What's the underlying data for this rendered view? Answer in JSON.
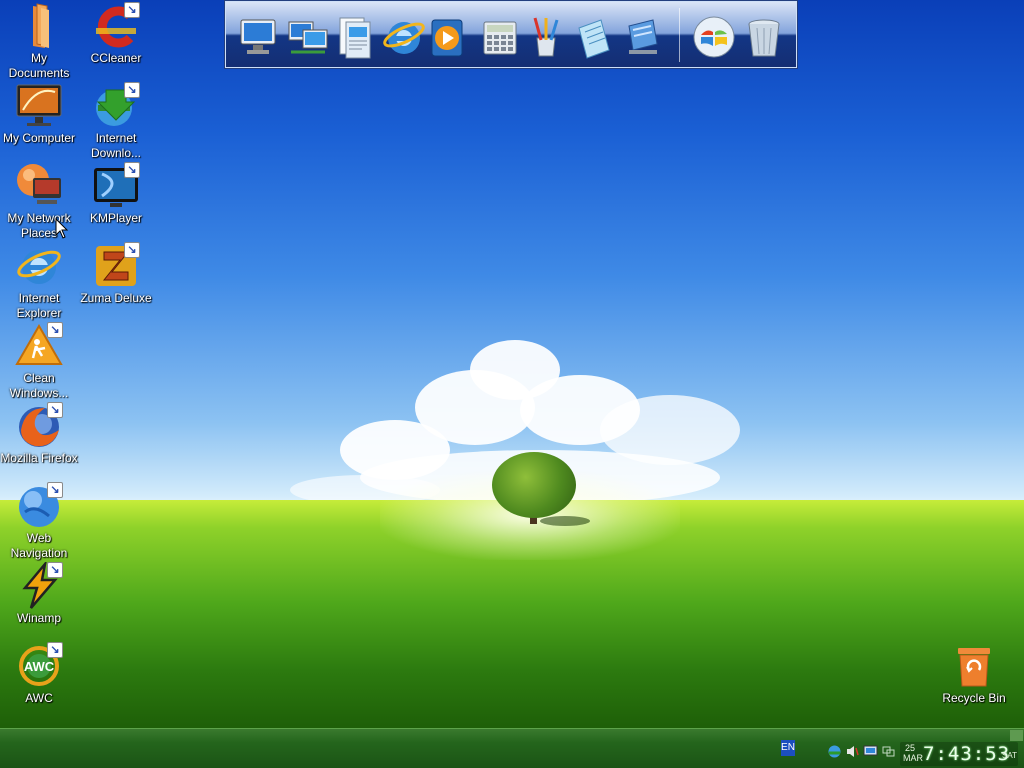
{
  "desktop": {
    "icons_col1": [
      {
        "label": "My Documents",
        "icon": "folder-icon",
        "shortcut": false
      },
      {
        "label": "My Computer",
        "icon": "computer-icon",
        "shortcut": false
      },
      {
        "label": "My Network Places",
        "icon": "network-places-icon",
        "shortcut": false
      },
      {
        "label": "Internet Explorer",
        "icon": "internet-explorer-icon",
        "shortcut": false
      },
      {
        "label": "Clean Windows...",
        "icon": "clean-windows-icon",
        "shortcut": true
      },
      {
        "label": "Mozilla Firefox",
        "icon": "firefox-icon",
        "shortcut": true
      },
      {
        "label": "Web Navigation",
        "icon": "globe-icon",
        "shortcut": true
      },
      {
        "label": "Winamp",
        "icon": "winamp-icon",
        "shortcut": true
      },
      {
        "label": "AWC",
        "icon": "awc-icon",
        "shortcut": true
      }
    ],
    "icons_col2": [
      {
        "label": "CCleaner",
        "icon": "ccleaner-icon",
        "shortcut": true
      },
      {
        "label": "Internet Downlo...",
        "icon": "internet-download-manager-icon",
        "shortcut": true
      },
      {
        "label": "KMPlayer",
        "icon": "kmplayer-icon",
        "shortcut": true
      },
      {
        "label": "Zuma Deluxe",
        "icon": "zuma-icon",
        "shortcut": true
      }
    ],
    "recycle_bin": {
      "label": "Recycle Bin",
      "icon": "recycle-bin-icon"
    },
    "shortcut_glyph": "↘"
  },
  "dock": {
    "items": [
      {
        "icon": "monitor-icon"
      },
      {
        "icon": "network-computers-icon"
      },
      {
        "icon": "documents-icon"
      },
      {
        "icon": "internet-explorer-icon"
      },
      {
        "icon": "media-player-icon"
      },
      {
        "icon": "calculator-icon"
      },
      {
        "icon": "paint-brushes-icon"
      },
      {
        "icon": "notepad-icon"
      },
      {
        "icon": "control-panel-icon"
      },
      {
        "icon": "windows-start-icon"
      },
      {
        "icon": "trash-icon"
      }
    ]
  },
  "taskbar": {
    "language": "EN",
    "tray_icons": [
      "network-tray-icon",
      "volume-tray-icon",
      "display-tray-icon",
      "connection-tray-icon"
    ],
    "date_day": "25",
    "date_month": "MAR",
    "time": "7:43:53",
    "weekday": "SAT"
  },
  "colors": {
    "sky_top": "#0a3fb8",
    "grass": "#4fa81b",
    "taskbar": "#24651c",
    "clock_text": "#eaffea"
  }
}
